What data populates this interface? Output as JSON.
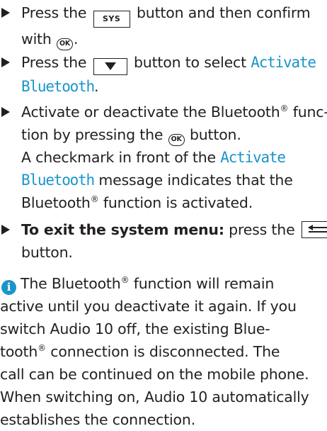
{
  "steps": [
    {
      "prefix": "Press the",
      "key_sys": "SYS",
      "middle": "button and then confirm",
      "line2_prefix": "with",
      "ok": "OK",
      "line2_suffix": "."
    },
    {
      "prefix": "Press the",
      "middle": "button to select",
      "display_a": "Activate",
      "display_b": "Bluetooth",
      "suffix": "."
    },
    {
      "line1_prefix": "Activate or deactivate the Bluetooth",
      "reg": "®",
      "line1_suffix": "func-",
      "line2_prefix": "tion by pressing the",
      "ok": "OK",
      "line2_suffix": "button.",
      "line3_prefix": "A checkmark in front of the",
      "display_a": "Activate",
      "display_b": "Bluetooth",
      "line4_suffix": "message indicates that the",
      "line5_prefix": "Bluetooth",
      "line5_suffix": "function is activated."
    },
    {
      "bold": "To exit the system menu:",
      "rest": "press the",
      "line2": "button."
    }
  ],
  "info": {
    "icon": "i",
    "lines": [
      [
        "The Bluetooth",
        "®",
        " function will remain"
      ],
      [
        "active until you deactivate it again. If you"
      ],
      [
        "switch Audio 10 off, the existing Blue-"
      ],
      [
        "tooth",
        "®",
        " connection is disconnected. The"
      ],
      [
        "call can be continued on the mobile phone."
      ],
      [
        "When switching on, Audio 10 automatically"
      ],
      [
        "establishes the connection."
      ]
    ]
  }
}
